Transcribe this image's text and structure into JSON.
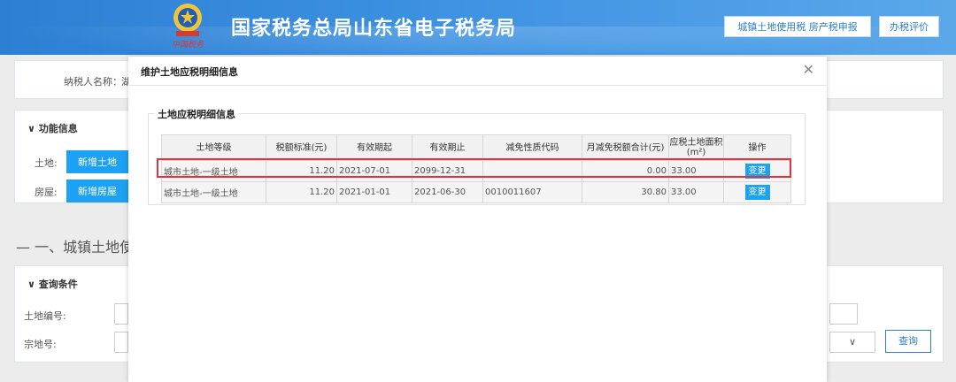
{
  "header": {
    "site_title": "国家税务总局山东省电子税务局",
    "emblem_subtext": "中国税务",
    "button_land_tax": "城镇土地使用税 房产税申报",
    "button_evaluation": "办税评价"
  },
  "background": {
    "taxpayer_label": "纳税人名称：",
    "taxpayer_value": "湖",
    "function_section": "功能信息",
    "land_label": "土地:",
    "add_land_button": "新增土地",
    "house_label": "房屋:",
    "add_house_button": "新增房屋",
    "section_heading": "一、城镇土地使",
    "query_section": "查询条件",
    "land_no_label": "土地编号:",
    "parcel_no_label": "宗地号:",
    "query_button": "查询"
  },
  "modal": {
    "title": "维护土地应税明细信息",
    "legend": "土地应税明细信息",
    "columns": [
      "土地等级",
      "税额标准(元)",
      "有效期起",
      "有效期止",
      "减免性质代码",
      "月减免税额合计(元)",
      "应税土地面积(m²)",
      "操作"
    ],
    "rows": [
      {
        "grade": "城市土地-一级土地",
        "standard": "11.20",
        "start": "2021-07-01",
        "end": "2099-12-31",
        "code": "",
        "relief": "0.00",
        "area": "33.00",
        "action": "变更"
      },
      {
        "grade": "城市土地-一级土地",
        "standard": "11.20",
        "start": "2021-01-01",
        "end": "2021-06-30",
        "code": "0010011607",
        "relief": "30.80",
        "area": "33.00",
        "action": "变更"
      }
    ]
  }
}
